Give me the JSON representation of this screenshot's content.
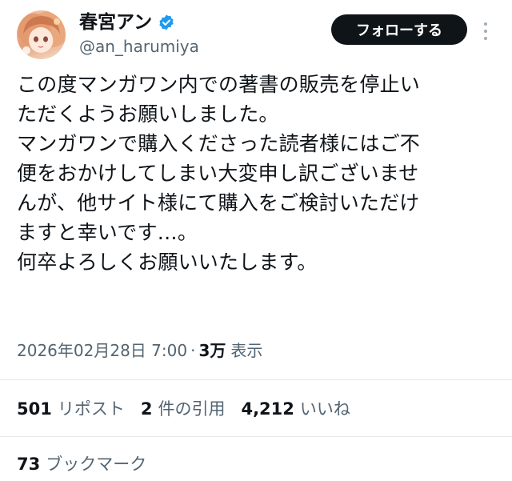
{
  "author": {
    "display_name": "春宮アン",
    "handle": "@an_harumiya",
    "verified": true,
    "verified_color": "#1d9bf0",
    "avatar_icon": "avatar-illustration"
  },
  "follow_button": {
    "label": "フォローする"
  },
  "more_menu": {
    "icon": "more-vertical-icon"
  },
  "tweet": {
    "lines": [
      "この度マンガワン内での著書の販売を停止い",
      "ただくようお願いしました。",
      "マンガワンで購入くださった読者様にはご不",
      "便をおかけしてしまい大変申し訳ございませ",
      "んが、他サイト様にて購入をご検討いただけ",
      "ますと幸いです…。",
      "何卒よろしくお願いいたします。"
    ]
  },
  "meta": {
    "timestamp": "2026年02月28日 7:00",
    "separator": "·",
    "views_count": "3万",
    "views_label": "表示"
  },
  "stats": {
    "reposts": {
      "count": "501",
      "label": "リポスト"
    },
    "quotes": {
      "count": "2",
      "label": "件の引用"
    },
    "likes": {
      "count": "4,212",
      "label": "いいね"
    }
  },
  "bookmarks": {
    "count": "73",
    "label": "ブックマーク"
  }
}
